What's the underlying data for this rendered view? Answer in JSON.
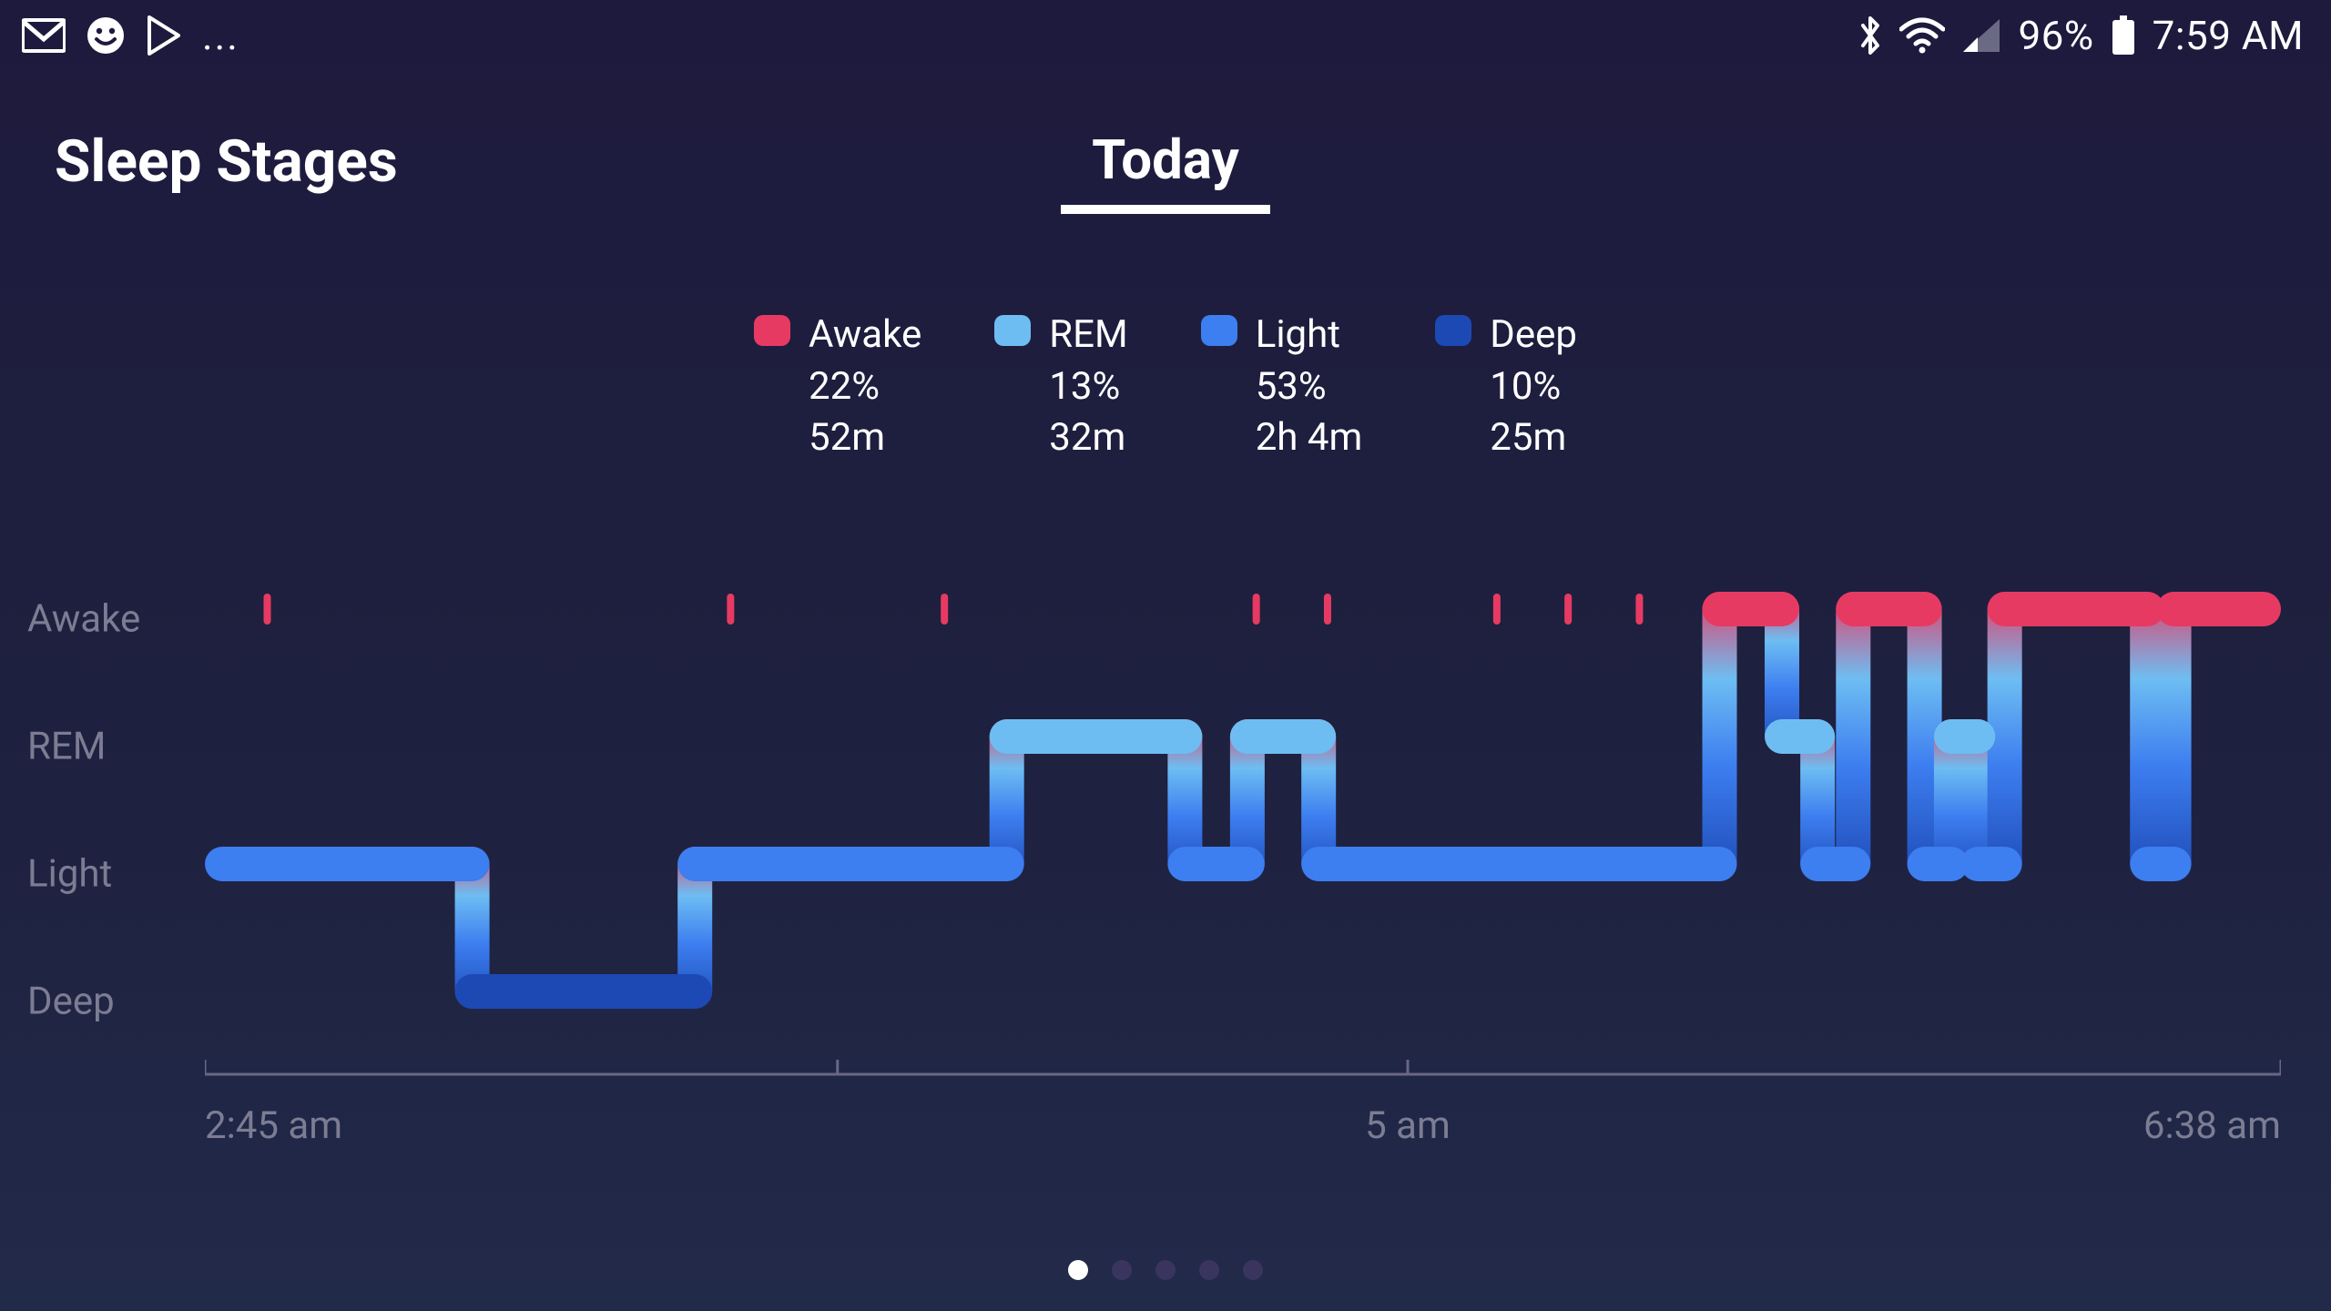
{
  "status_bar": {
    "battery_text": "96%",
    "time_text": "7:59 AM",
    "overflow": "..."
  },
  "header": {
    "title": "Sleep Stages",
    "date_label": "Today"
  },
  "legend": [
    {
      "name": "Awake",
      "percent": "22%",
      "duration": "52m",
      "color": "#e73a63"
    },
    {
      "name": "REM",
      "percent": "13%",
      "duration": "32m",
      "color": "#6ebdf2"
    },
    {
      "name": "Light",
      "percent": "53%",
      "duration": "2h 4m",
      "color": "#3d7ef0"
    },
    {
      "name": "Deep",
      "percent": "10%",
      "duration": "25m",
      "color": "#1d49b4"
    }
  ],
  "colors": {
    "awake": "#e73a63",
    "rem": "#6ebdf2",
    "light": "#3d7ef0",
    "deep": "#1d49b4",
    "axis": "#686884",
    "ylabel": "#7c7c93"
  },
  "pages": {
    "count": 5,
    "active_index": 0
  },
  "chart_data": {
    "type": "step-area",
    "title": "Sleep Stages",
    "y_categories": [
      "Awake",
      "REM",
      "Light",
      "Deep"
    ],
    "x_start_label": "2:45 am",
    "x_mid_label": "5 am",
    "x_end_label": "6:38 am",
    "x_start_minutes": 165,
    "x_mid_minutes": 300,
    "x_end_minutes": 398,
    "segments": [
      {
        "stage": "Light",
        "start": 165,
        "end": 195
      },
      {
        "stage": "Deep",
        "start": 195,
        "end": 220
      },
      {
        "stage": "Light",
        "start": 220,
        "end": 255
      },
      {
        "stage": "REM",
        "start": 255,
        "end": 275
      },
      {
        "stage": "Light",
        "start": 275,
        "end": 282
      },
      {
        "stage": "REM",
        "start": 282,
        "end": 290
      },
      {
        "stage": "Light",
        "start": 290,
        "end": 335
      },
      {
        "stage": "Awake",
        "start": 335,
        "end": 342
      },
      {
        "stage": "REM",
        "start": 342,
        "end": 346
      },
      {
        "stage": "Light",
        "start": 346,
        "end": 350
      },
      {
        "stage": "Awake",
        "start": 350,
        "end": 358
      },
      {
        "stage": "Light",
        "start": 358,
        "end": 361
      },
      {
        "stage": "REM",
        "start": 361,
        "end": 364
      },
      {
        "stage": "Light",
        "start": 364,
        "end": 367
      },
      {
        "stage": "Awake",
        "start": 367,
        "end": 383
      },
      {
        "stage": "Light",
        "start": 383,
        "end": 386
      },
      {
        "stage": "Awake",
        "start": 386,
        "end": 398
      }
    ],
    "awake_ticks": [
      172,
      224,
      248,
      283,
      291,
      310,
      318,
      326
    ],
    "x_axis_ticks": [
      165,
      236,
      300,
      398
    ]
  }
}
